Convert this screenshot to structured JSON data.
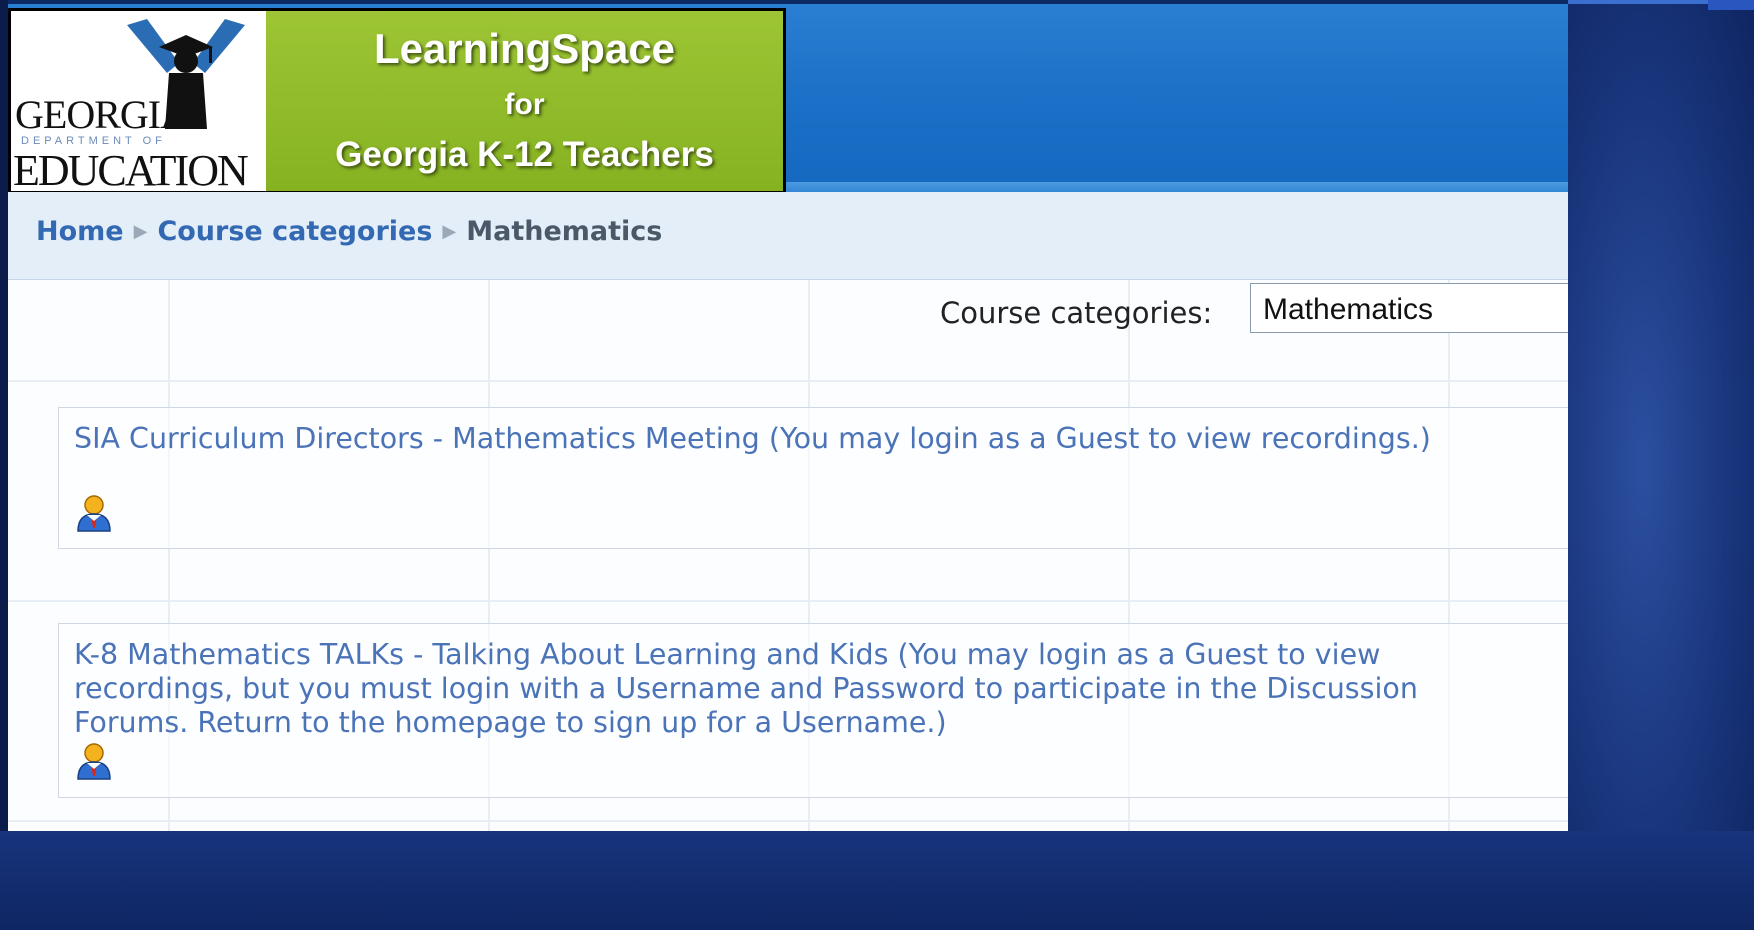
{
  "logo": {
    "org_line1": "GEORGIA",
    "org_line2": "DEPARTMENT OF",
    "org_line3": "EDUCATION",
    "title": "LearningSpace",
    "subtitle_for": "for",
    "subtitle_audience": "Georgia K-12 Teachers"
  },
  "breadcrumb": {
    "home": "Home",
    "categories": "Course categories",
    "current": "Mathematics",
    "separator": "▶"
  },
  "category_selector": {
    "label": "Course categories:",
    "selected": "Mathematics"
  },
  "courses": [
    {
      "name": "SIA Curriculum Directors - Mathematics Meeting (You may login as a Guest to view recordings.)",
      "icon": "guest-user-icon"
    },
    {
      "name": "K-8 Mathematics TALKs - Talking About Learning and Kids (You may login as a Guest to view recordings, but you must login with a Username and Password to participate in the Discussion Forums. Return to the homepage to sign up for a Username.)",
      "icon": "guest-user-icon"
    }
  ],
  "colors": {
    "link": "#4b73b8",
    "header_blue": "#1a6fc6",
    "logo_green": "#8db826"
  }
}
